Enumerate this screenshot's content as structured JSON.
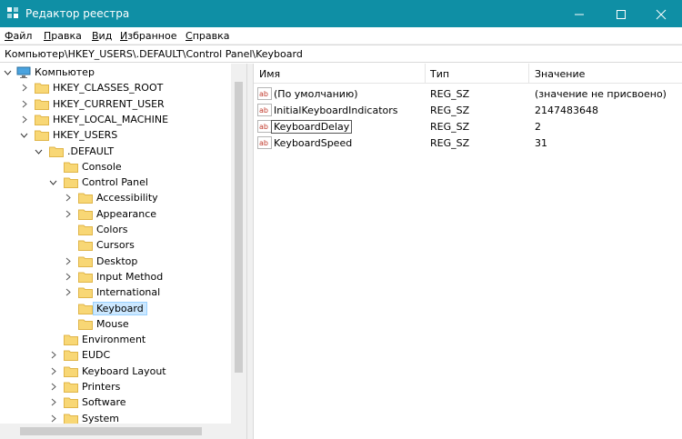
{
  "window": {
    "title": "Редактор реестра",
    "accent": "#0f8fa5"
  },
  "menu": [
    {
      "underline": "Ф",
      "rest": "айл"
    },
    {
      "underline": "П",
      "rest": "равка"
    },
    {
      "underline": "В",
      "rest": "ид"
    },
    {
      "underline": "И",
      "rest": "збранное"
    },
    {
      "underline": "С",
      "rest": "правка"
    }
  ],
  "address": "Компьютер\\HKEY_USERS\\.DEFAULT\\Control Panel\\Keyboard",
  "tree": [
    {
      "label": "Компьютер",
      "icon": "computer-icon",
      "chev": "down"
    },
    {
      "label": "HKEY_CLASSES_ROOT",
      "icon": "folder-icon",
      "chev": "right"
    },
    {
      "label": "HKEY_CURRENT_USER",
      "icon": "folder-icon",
      "chev": "right"
    },
    {
      "label": "HKEY_LOCAL_MACHINE",
      "icon": "folder-icon",
      "chev": "right"
    },
    {
      "label": "HKEY_USERS",
      "icon": "folder-icon",
      "chev": "down"
    },
    {
      "label": ".DEFAULT",
      "icon": "folder-icon",
      "chev": "down"
    },
    {
      "label": "Console",
      "icon": "folder-icon",
      "chev": "none"
    },
    {
      "label": "Control Panel",
      "icon": "folder-icon",
      "chev": "down"
    },
    {
      "label": "Accessibility",
      "icon": "folder-icon",
      "chev": "right"
    },
    {
      "label": "Appearance",
      "icon": "folder-icon",
      "chev": "right"
    },
    {
      "label": "Colors",
      "icon": "folder-icon",
      "chev": "none"
    },
    {
      "label": "Cursors",
      "icon": "folder-icon",
      "chev": "none"
    },
    {
      "label": "Desktop",
      "icon": "folder-icon",
      "chev": "right"
    },
    {
      "label": "Input Method",
      "icon": "folder-icon",
      "chev": "right"
    },
    {
      "label": "International",
      "icon": "folder-icon",
      "chev": "right"
    },
    {
      "label": "Keyboard",
      "icon": "folder-icon",
      "chev": "none",
      "selected": true
    },
    {
      "label": "Mouse",
      "icon": "folder-icon",
      "chev": "none"
    },
    {
      "label": "Environment",
      "icon": "folder-icon",
      "chev": "none"
    },
    {
      "label": "EUDC",
      "icon": "folder-icon",
      "chev": "right"
    },
    {
      "label": "Keyboard Layout",
      "icon": "folder-icon",
      "chev": "right"
    },
    {
      "label": "Printers",
      "icon": "folder-icon",
      "chev": "right"
    },
    {
      "label": "Software",
      "icon": "folder-icon",
      "chev": "right"
    },
    {
      "label": "System",
      "icon": "folder-icon",
      "chev": "right"
    }
  ],
  "columns": {
    "name": "Имя",
    "type": "Тип",
    "value": "Значение"
  },
  "values": [
    {
      "name": "(По умолчанию)",
      "type": "REG_SZ",
      "value": "(значение не присвоено)"
    },
    {
      "name": "InitialKeyboardIndicators",
      "type": "REG_SZ",
      "value": "2147483648"
    },
    {
      "name": "KeyboardDelay",
      "type": "REG_SZ",
      "value": "2",
      "focused": true
    },
    {
      "name": "KeyboardSpeed",
      "type": "REG_SZ",
      "value": "31"
    }
  ]
}
